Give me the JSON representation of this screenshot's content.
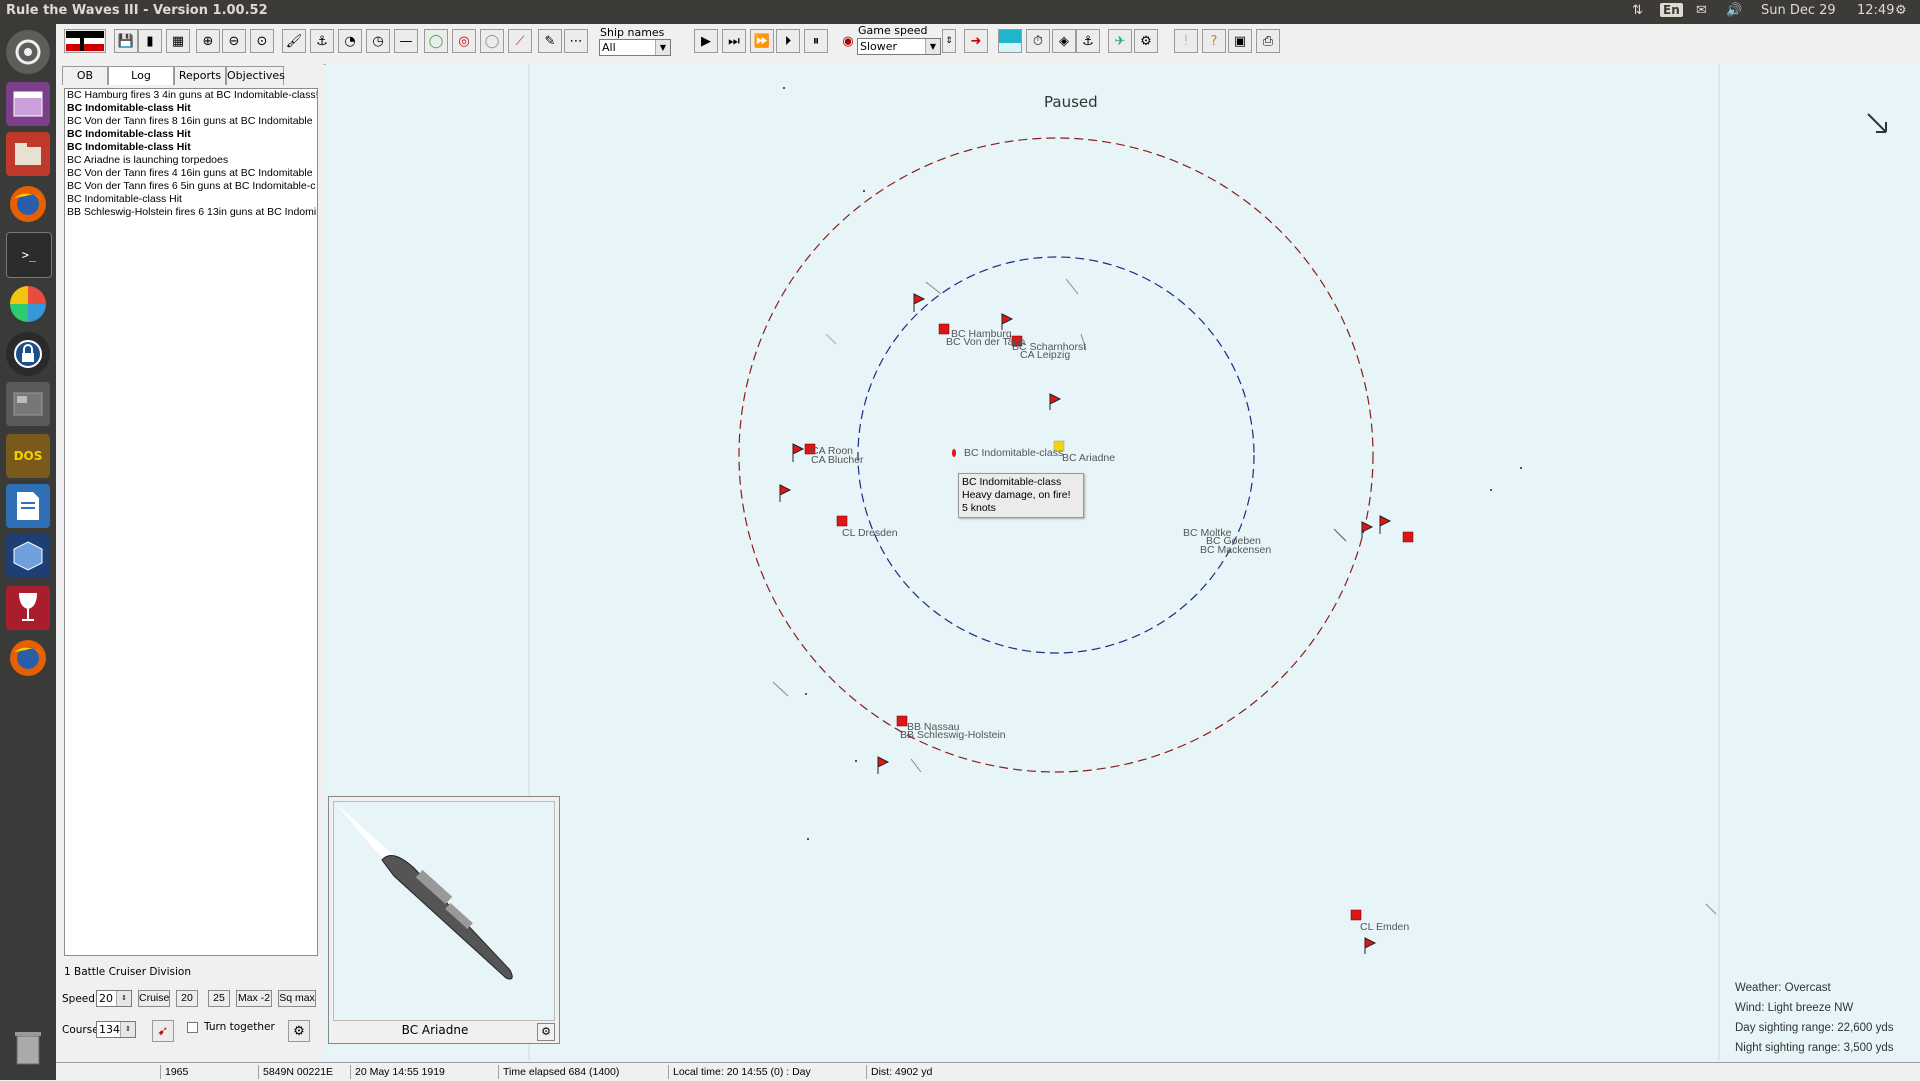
{
  "window": {
    "title": "Rule the Waves III - Version 1.00.52"
  },
  "system": {
    "lang": "En",
    "date": "Sun Dec 29",
    "time": "12:49"
  },
  "toolbar": {
    "ship_names_label": "Ship names",
    "ship_names_value": "All",
    "game_speed_label": "Game speed",
    "game_speed_value": "Slower"
  },
  "tabs": [
    {
      "label": "OB"
    },
    {
      "label": "Log",
      "active": true
    },
    {
      "label": "Reports"
    },
    {
      "label": "Objectives"
    }
  ],
  "log": [
    {
      "text": "BC Hamburg fires 3 4in guns at BC Indomitable-class!",
      "bold": false
    },
    {
      "text": "BC Indomitable-class Hit",
      "bold": true
    },
    {
      "text": "BC Von der Tann fires 8 16in guns at BC Indomitable",
      "bold": false
    },
    {
      "text": "BC Indomitable-class Hit",
      "bold": true
    },
    {
      "text": "BC Indomitable-class Hit",
      "bold": true
    },
    {
      "text": "BC Ariadne is launching torpedoes",
      "bold": false
    },
    {
      "text": "BC Von der Tann fires 4 16in guns at BC Indomitable",
      "bold": false
    },
    {
      "text": "BC Von der Tann fires 6 5in guns at BC Indomitable-c",
      "bold": false
    },
    {
      "text": "BC Indomitable-class Hit",
      "bold": false
    },
    {
      "text": "BB Schleswig-Holstein fires 6 13in guns at BC Indomi",
      "bold": false
    }
  ],
  "division": {
    "name": "1 Battle Cruiser Division",
    "speed_label": "Speed",
    "speed_value": "20",
    "cruise": "Cruise",
    "b20": "20",
    "b25": "25",
    "max2": "Max -2",
    "sqmax": "Sq max",
    "course_label": "Course",
    "course_value": "134",
    "turn_together": "Turn together"
  },
  "preview": {
    "ship_name": "BC Ariadne"
  },
  "map": {
    "paused": "Paused",
    "ships": [
      {
        "label": "BC Hamburg"
      },
      {
        "label": "BC Von der Tann"
      },
      {
        "label": "BC Scharnhorst"
      },
      {
        "label": "CA Leipzig"
      },
      {
        "label": "CA Roon"
      },
      {
        "label": "CA Blucher"
      },
      {
        "label": "BC Indomitable-class"
      },
      {
        "label": "BC Ariadne"
      },
      {
        "label": "CL Dresden"
      },
      {
        "label": "BC Moltke"
      },
      {
        "label": "BC Goeben"
      },
      {
        "label": "BC Mackensen"
      },
      {
        "label": "BB Nassau"
      },
      {
        "label": "BB Schleswig-Holstein"
      },
      {
        "label": "CL Emden"
      }
    ],
    "tooltip": {
      "line1": "BC Indomitable-class",
      "line2": "Heavy damage, on fire!",
      "line3": "5 knots"
    },
    "weather": {
      "weather": "Weather: Overcast",
      "wind": "Wind: Light breeze  NW",
      "day": "Day sighting range: 22,600 yds",
      "night": "Night sighting range: 3,500 yds"
    }
  },
  "status": {
    "year": "1965",
    "position": "5849N 00221E",
    "date": "20 May 14:55 1919",
    "elapsed": "Time elapsed 684 (1400)",
    "local": "Local time: 20 14:55 (0) : Day",
    "dist": "Dist: 4902 yd"
  }
}
